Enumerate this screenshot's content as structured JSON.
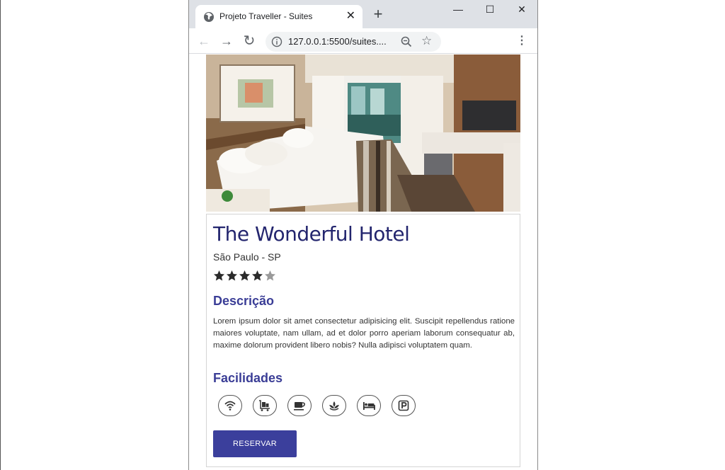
{
  "browser": {
    "tab_title": "Projeto Traveller - Suites",
    "tab_close": "✕",
    "new_tab": "+",
    "minimize": "—",
    "maximize": "☐",
    "close": "✕",
    "url": "127.0.0.1:5500/suites....",
    "back": "←",
    "forward": "→",
    "reload": "↻",
    "star": "☆",
    "menu": "⋮"
  },
  "hotel": {
    "name": "The Wonderful Hotel",
    "location": "São Paulo - SP",
    "rating": 4,
    "max_rating": 5,
    "description_title": "Descrição",
    "description": "Lorem ipsum dolor sit amet consectetur adipisicing elit. Suscipit repellendus ratione maiores voluptate, nam ullam, ad et dolor porro aperiam laborum consequatur ab, maxime dolorum provident libero nobis? Nulla adipisci voluptatem quam.",
    "facilities_title": "Facilidades",
    "facilities": [
      "wifi-icon",
      "luggage-cart-icon",
      "coffee-icon",
      "spa-icon",
      "bed-icon",
      "parking-icon"
    ],
    "reserve_label": "RESERVAR"
  },
  "colors": {
    "title": "#23256e",
    "accent": "#3b3f9c",
    "section": "#3a3d96"
  }
}
